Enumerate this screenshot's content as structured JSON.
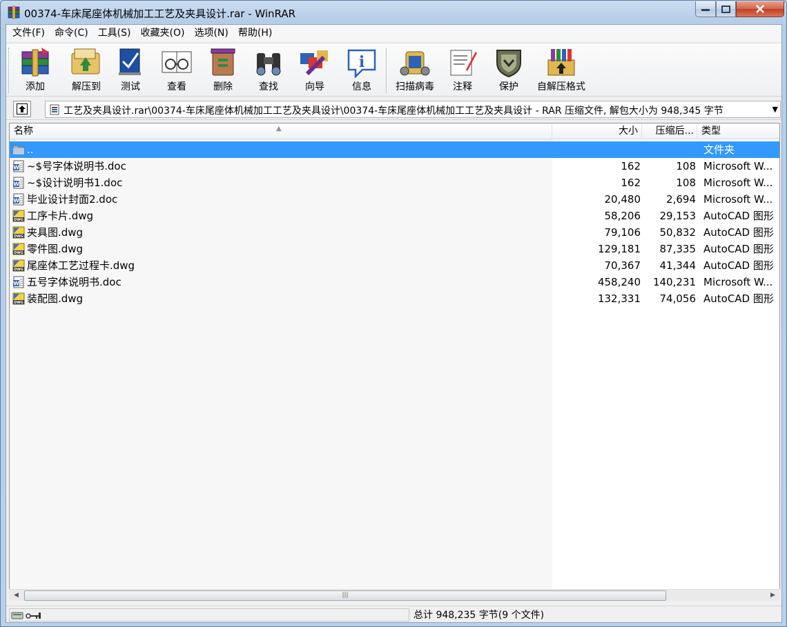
{
  "window": {
    "title": "00374-车床尾座体机械加工工艺及夹具设计.rar - WinRAR"
  },
  "menu": [
    {
      "id": "file",
      "label": "文件(F)"
    },
    {
      "id": "commands",
      "label": "命令(C)"
    },
    {
      "id": "tools",
      "label": "工具(S)"
    },
    {
      "id": "favorites",
      "label": "收藏夹(O)"
    },
    {
      "id": "options",
      "label": "选项(N)"
    },
    {
      "id": "help",
      "label": "帮助(H)"
    }
  ],
  "toolbar": [
    {
      "id": "add",
      "label": "添加",
      "icon": "add-archive-icon"
    },
    {
      "id": "extract",
      "label": "解压到",
      "icon": "extract-to-icon"
    },
    {
      "id": "test",
      "label": "测试",
      "icon": "test-icon"
    },
    {
      "id": "view",
      "label": "查看",
      "icon": "view-icon"
    },
    {
      "id": "delete",
      "label": "删除",
      "icon": "delete-icon"
    },
    {
      "id": "find",
      "label": "查找",
      "icon": "binoculars-icon"
    },
    {
      "id": "wizard",
      "label": "向导",
      "icon": "wizard-icon"
    },
    {
      "id": "info",
      "label": "信息",
      "icon": "info-icon"
    },
    {
      "id": "scan",
      "label": "扫描病毒",
      "icon": "virus-scan-icon"
    },
    {
      "id": "comment",
      "label": "注释",
      "icon": "comment-icon"
    },
    {
      "id": "protect",
      "label": "保护",
      "icon": "shield-icon"
    },
    {
      "id": "sfx",
      "label": "自解压格式",
      "icon": "sfx-icon"
    }
  ],
  "address": {
    "path": "工艺及夹具设计.rar\\00374-车床尾座体机械加工工艺及夹具设计\\00374-车床尾座体机械加工工艺及夹具设计 - RAR 压缩文件, 解包大小为 948,345 字节"
  },
  "columns": {
    "name": "名称",
    "size": "大小",
    "packed": "压缩后...",
    "type": "类型"
  },
  "files": [
    {
      "name": "..",
      "size": "",
      "packed": "",
      "type": "文件夹",
      "kind": "folder",
      "selected": true
    },
    {
      "name": "~$号字体说明书.doc",
      "size": "162",
      "packed": "108",
      "type": "Microsoft W...",
      "kind": "doc"
    },
    {
      "name": "~$设计说明书1.doc",
      "size": "162",
      "packed": "108",
      "type": "Microsoft W...",
      "kind": "doc"
    },
    {
      "name": "毕业设计封面2.doc",
      "size": "20,480",
      "packed": "2,694",
      "type": "Microsoft W...",
      "kind": "doc"
    },
    {
      "name": "工序卡片.dwg",
      "size": "58,206",
      "packed": "29,153",
      "type": "AutoCAD 图形",
      "kind": "dwg"
    },
    {
      "name": "夹具图.dwg",
      "size": "79,106",
      "packed": "50,832",
      "type": "AutoCAD 图形",
      "kind": "dwg"
    },
    {
      "name": "零件图.dwg",
      "size": "129,181",
      "packed": "87,335",
      "type": "AutoCAD 图形",
      "kind": "dwg"
    },
    {
      "name": "尾座体工艺过程卡.dwg",
      "size": "70,367",
      "packed": "41,344",
      "type": "AutoCAD 图形",
      "kind": "dwg"
    },
    {
      "name": "五号字体说明书.doc",
      "size": "458,240",
      "packed": "140,231",
      "type": "Microsoft W...",
      "kind": "doc"
    },
    {
      "name": "装配图.dwg",
      "size": "132,331",
      "packed": "74,056",
      "type": "AutoCAD 图形",
      "kind": "dwg"
    }
  ],
  "status": {
    "summary": "总计 948,235 字节(9 个文件)"
  }
}
